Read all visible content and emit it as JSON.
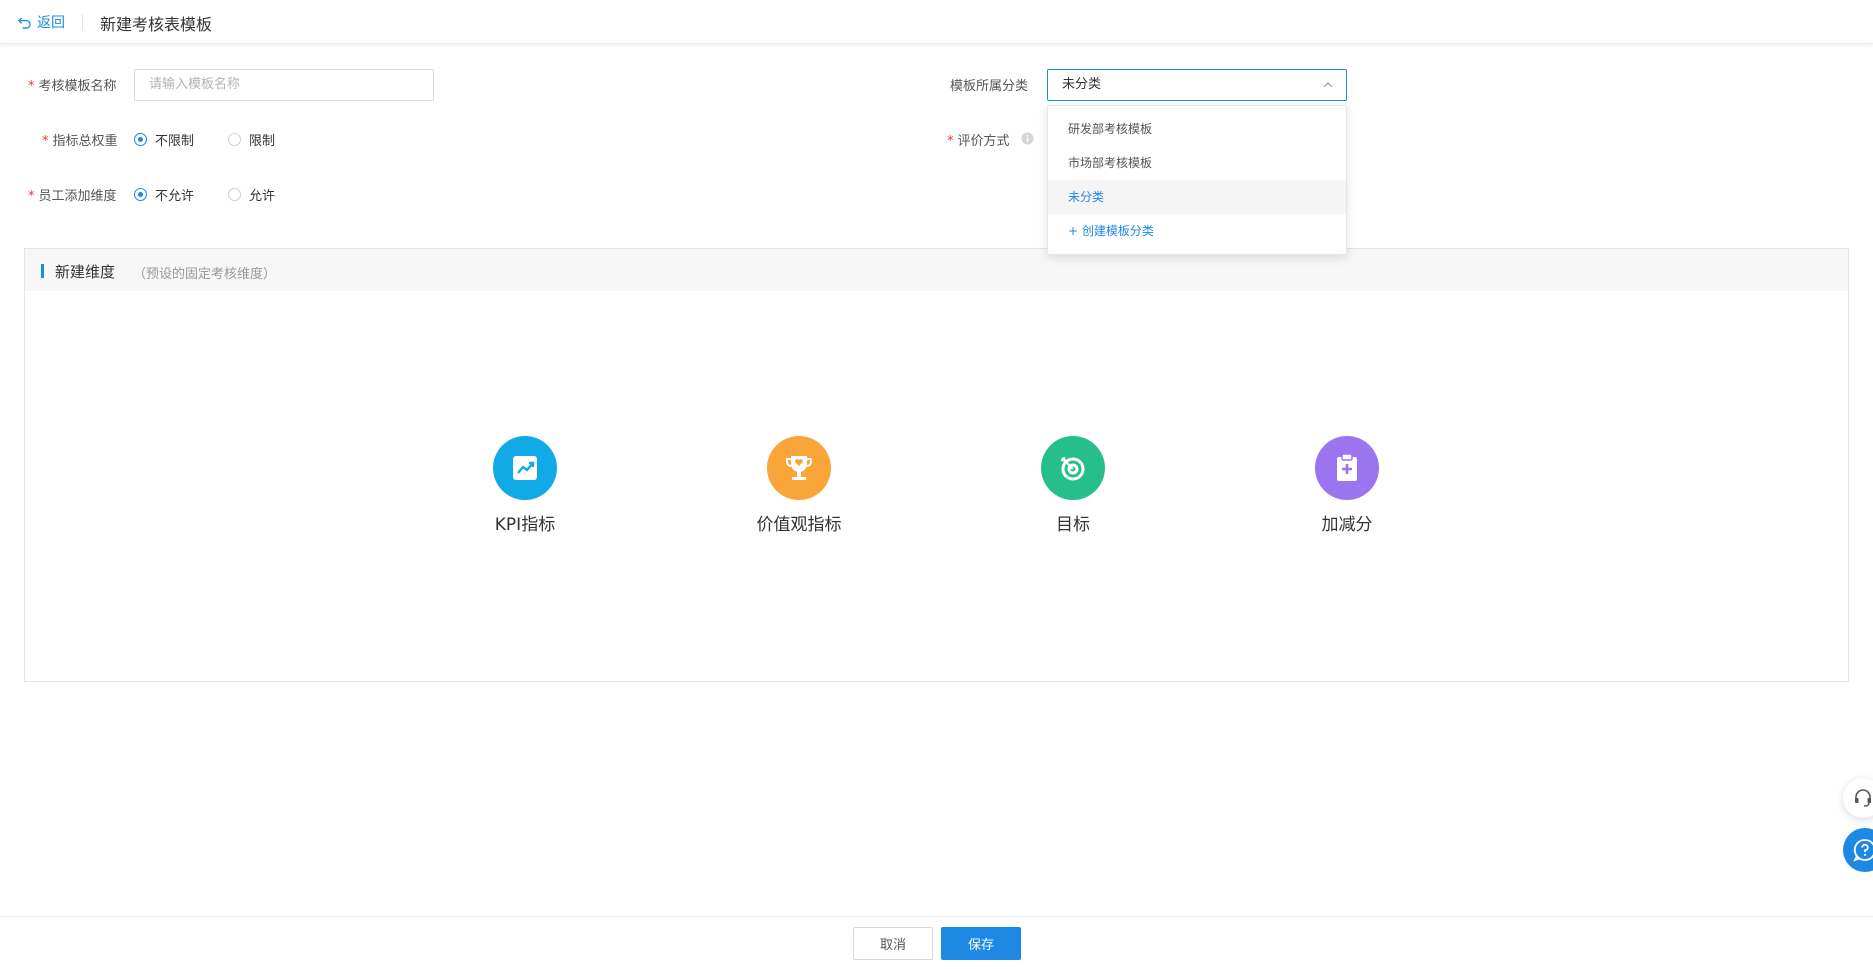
{
  "header": {
    "back_label": "返回",
    "title": "新建考核表模板"
  },
  "form": {
    "name": {
      "label": "考核模板名称",
      "placeholder": "请输入模板名称"
    },
    "category": {
      "label": "模板所属分类",
      "value": "未分类"
    },
    "weight": {
      "label": "指标总权重",
      "options": [
        "不限制",
        "限制"
      ],
      "selected": "不限制"
    },
    "evaluation": {
      "label": "评价方式"
    },
    "employee_add": {
      "label": "员工添加维度",
      "options": [
        "不允许",
        "允许"
      ],
      "selected": "不允许"
    }
  },
  "dropdown": {
    "options": [
      "研发部考核模板",
      "市场部考核模板",
      "未分类"
    ],
    "selected": "未分类",
    "create_label": "+ 创建模板分类"
  },
  "panel": {
    "title": "新建维度",
    "subtitle": "（预设的固定考核维度）",
    "dimensions": [
      {
        "label": "KPI指标",
        "icon": "chart-trend-icon",
        "color": "#11a9e6"
      },
      {
        "label": "价值观指标",
        "icon": "trophy-icon",
        "color": "#f9a53a"
      },
      {
        "label": "目标",
        "icon": "target-icon",
        "color": "#26bf8c"
      },
      {
        "label": "加减分",
        "icon": "clipboard-plus-icon",
        "color": "#9b74f0"
      }
    ]
  },
  "footer": {
    "cancel_label": "取消",
    "save_label": "保存"
  },
  "colors": {
    "accent": "#1e88e5",
    "required": "#e53935"
  }
}
